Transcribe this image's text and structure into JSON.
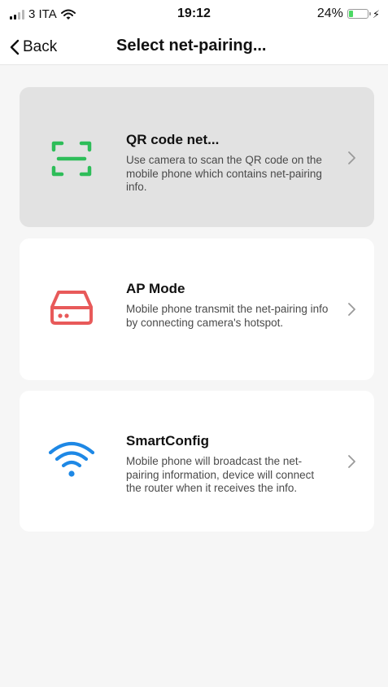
{
  "status_bar": {
    "carrier": "3 ITA",
    "time": "19:12",
    "battery_percent": "24%",
    "battery_level": 0.24,
    "signal_bars_active": 2,
    "charging": true,
    "wifi_icon": "wifi-icon",
    "battery_color": "#4cd964"
  },
  "nav": {
    "back_label": "Back",
    "title": "Select net-pairing..."
  },
  "options": [
    {
      "title": "QR code net...",
      "description": "Use camera to scan the QR code on the mobile phone which contains net-pairing info.",
      "icon": "qr-scan-icon",
      "icon_color": "#2ebd59",
      "selected": true
    },
    {
      "title": "AP Mode",
      "description": "Mobile phone transmit the net-pairing info by connecting camera's hotspot.",
      "icon": "router-icon",
      "icon_color": "#e85a5a",
      "selected": false
    },
    {
      "title": "SmartConfig",
      "description": "Mobile phone will broadcast the net-pairing information, device will connect the router when it receives the info.",
      "icon": "wifi-icon",
      "icon_color": "#1e88e5",
      "selected": false
    }
  ],
  "colors": {
    "background": "#f6f6f6",
    "card": "#ffffff",
    "card_selected": "#e2e2e2",
    "chevron": "#9a9a9a"
  }
}
